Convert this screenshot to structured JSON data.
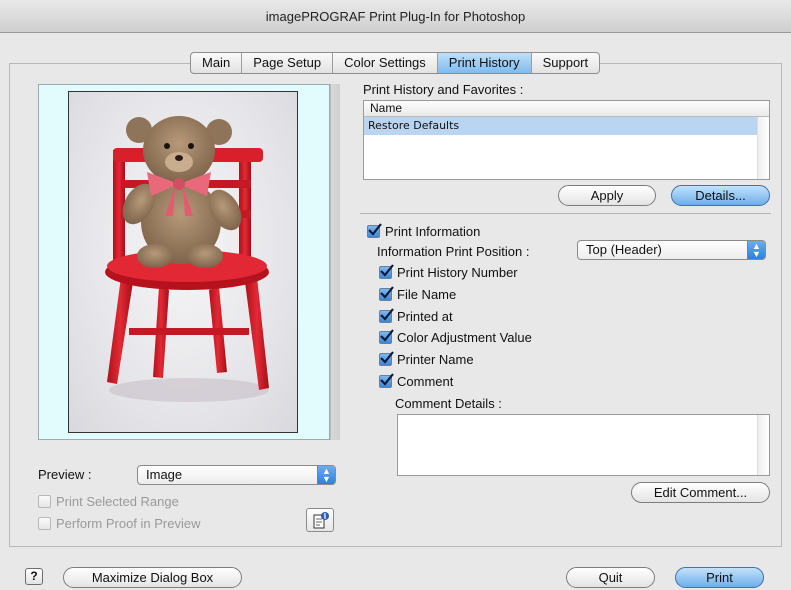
{
  "window": {
    "title": "imagePROGRAF Print Plug-In for Photoshop"
  },
  "tabs": [
    {
      "label": "Main"
    },
    {
      "label": "Page Setup"
    },
    {
      "label": "Color Settings"
    },
    {
      "label": "Print History",
      "active": true
    },
    {
      "label": "Support"
    }
  ],
  "preview": {
    "label": "Preview :",
    "mode": "Image",
    "print_selected_range": "Print Selected Range",
    "perform_proof": "Perform Proof in Preview",
    "image_subject": "teddy bear on red chair"
  },
  "history": {
    "title": "Print History and Favorites :",
    "column": "Name",
    "rows": [
      "Restore Defaults"
    ],
    "apply_label": "Apply",
    "details_label": "Details..."
  },
  "print_info": {
    "enabled_label": "Print Information",
    "position_label": "Information Print Position :",
    "position_value": "Top (Header)",
    "options": [
      {
        "label": "Print History Number",
        "checked": true
      },
      {
        "label": "File Name",
        "checked": true
      },
      {
        "label": "Printed at",
        "checked": true
      },
      {
        "label": "Color Adjustment Value",
        "checked": true
      },
      {
        "label": "Printer Name",
        "checked": true
      },
      {
        "label": "Comment",
        "checked": true
      }
    ],
    "comment_details_label": "Comment Details :",
    "comment_value": "",
    "edit_comment_label": "Edit Comment..."
  },
  "footer": {
    "help": "?",
    "maximize_label": "Maximize Dialog Box",
    "quit_label": "Quit",
    "print_label": "Print"
  },
  "colors": {
    "accent_blue": "#6eaee9",
    "preview_bg": "#e2fbfc",
    "chair_red": "#d8232f"
  }
}
